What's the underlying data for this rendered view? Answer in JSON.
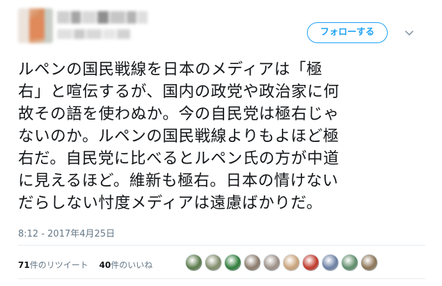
{
  "tweet": {
    "follow_label": "フォローする",
    "text_lines": [
      "ルペンの国民戦線を日本のメディアは「極",
      "右」と喧伝するが、国内の政党や政治家に何",
      "故その語を使わぬか。今の自民党は極右じゃ",
      "ないのか。ルペンの国民戦線よりもよほど極",
      "右だ。自民党に比べるとルペン氏の方が中道",
      "に見えるほど。維新も極右。日本の情けない",
      "だらしない忖度メディアは遠慮ばかりだ。"
    ],
    "timestamp": "8:12 - 2017年4月25日",
    "retweet_count": "71",
    "retweet_label": "件のリツイート",
    "like_count": "40",
    "like_label": "件のいいね"
  },
  "colors": {
    "accent": "#1da1f2",
    "text": "#14171a",
    "muted": "#657786",
    "divider": "#e6ecf0"
  },
  "icons": {
    "caret": "chevron-down-icon"
  },
  "likers": [
    {
      "name": "liker-avatar-1",
      "color": "#5a7a4a"
    },
    {
      "name": "liker-avatar-2",
      "color": "#7f8c6a"
    },
    {
      "name": "liker-avatar-3",
      "color": "#2e7d3a"
    },
    {
      "name": "liker-avatar-4",
      "color": "#8a7a6a"
    },
    {
      "name": "liker-avatar-5",
      "color": "#9c8f86"
    },
    {
      "name": "liker-avatar-6",
      "color": "#c9a37a"
    },
    {
      "name": "liker-avatar-7",
      "color": "#c0392b"
    },
    {
      "name": "liker-avatar-8",
      "color": "#6b7fa3"
    },
    {
      "name": "liker-avatar-9",
      "color": "#5e8c6a"
    },
    {
      "name": "liker-avatar-10",
      "color": "#8b7355"
    }
  ]
}
